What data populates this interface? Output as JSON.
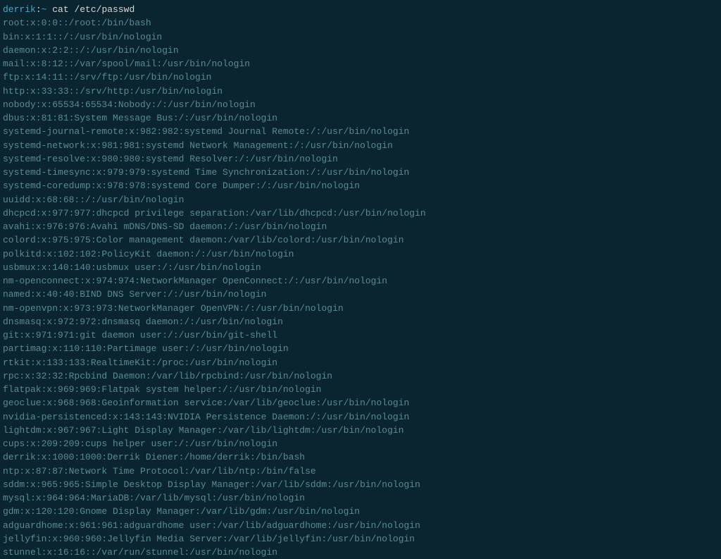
{
  "prompt": {
    "user": "derrik",
    "separator": ":",
    "path": "~",
    "command": " cat /etc/passwd"
  },
  "passwd_lines": [
    "root:x:0:0::/root:/bin/bash",
    "bin:x:1:1::/:/usr/bin/nologin",
    "daemon:x:2:2::/:/usr/bin/nologin",
    "mail:x:8:12::/var/spool/mail:/usr/bin/nologin",
    "ftp:x:14:11::/srv/ftp:/usr/bin/nologin",
    "http:x:33:33::/srv/http:/usr/bin/nologin",
    "nobody:x:65534:65534:Nobody:/:/usr/bin/nologin",
    "dbus:x:81:81:System Message Bus:/:/usr/bin/nologin",
    "systemd-journal-remote:x:982:982:systemd Journal Remote:/:/usr/bin/nologin",
    "systemd-network:x:981:981:systemd Network Management:/:/usr/bin/nologin",
    "systemd-resolve:x:980:980:systemd Resolver:/:/usr/bin/nologin",
    "systemd-timesync:x:979:979:systemd Time Synchronization:/:/usr/bin/nologin",
    "systemd-coredump:x:978:978:systemd Core Dumper:/:/usr/bin/nologin",
    "uuidd:x:68:68::/:/usr/bin/nologin",
    "dhcpcd:x:977:977:dhcpcd privilege separation:/var/lib/dhcpcd:/usr/bin/nologin",
    "avahi:x:976:976:Avahi mDNS/DNS-SD daemon:/:/usr/bin/nologin",
    "colord:x:975:975:Color management daemon:/var/lib/colord:/usr/bin/nologin",
    "polkitd:x:102:102:PolicyKit daemon:/:/usr/bin/nologin",
    "usbmux:x:140:140:usbmux user:/:/usr/bin/nologin",
    "nm-openconnect:x:974:974:NetworkManager OpenConnect:/:/usr/bin/nologin",
    "named:x:40:40:BIND DNS Server:/:/usr/bin/nologin",
    "nm-openvpn:x:973:973:NetworkManager OpenVPN:/:/usr/bin/nologin",
    "dnsmasq:x:972:972:dnsmasq daemon:/:/usr/bin/nologin",
    "git:x:971:971:git daemon user:/:/usr/bin/git-shell",
    "partimag:x:110:110:Partimage user:/:/usr/bin/nologin",
    "rtkit:x:133:133:RealtimeKit:/proc:/usr/bin/nologin",
    "rpc:x:32:32:Rpcbind Daemon:/var/lib/rpcbind:/usr/bin/nologin",
    "flatpak:x:969:969:Flatpak system helper:/:/usr/bin/nologin",
    "geoclue:x:968:968:Geoinformation service:/var/lib/geoclue:/usr/bin/nologin",
    "nvidia-persistenced:x:143:143:NVIDIA Persistence Daemon:/:/usr/bin/nologin",
    "lightdm:x:967:967:Light Display Manager:/var/lib/lightdm:/usr/bin/nologin",
    "cups:x:209:209:cups helper user:/:/usr/bin/nologin",
    "derrik:x:1000:1000:Derrik Diener:/home/derrik:/bin/bash",
    "ntp:x:87:87:Network Time Protocol:/var/lib/ntp:/bin/false",
    "sddm:x:965:965:Simple Desktop Display Manager:/var/lib/sddm:/usr/bin/nologin",
    "mysql:x:964:964:MariaDB:/var/lib/mysql:/usr/bin/nologin",
    "gdm:x:120:120:Gnome Display Manager:/var/lib/gdm:/usr/bin/nologin",
    "adguardhome:x:961:961:adguardhome user:/var/lib/adguardhome:/usr/bin/nologin",
    "jellyfin:x:960:960:Jellyfin Media Server:/var/lib/jellyfin:/usr/bin/nologin",
    "stunnel:x:16:16::/var/run/stunnel:/usr/bin/nologin"
  ]
}
